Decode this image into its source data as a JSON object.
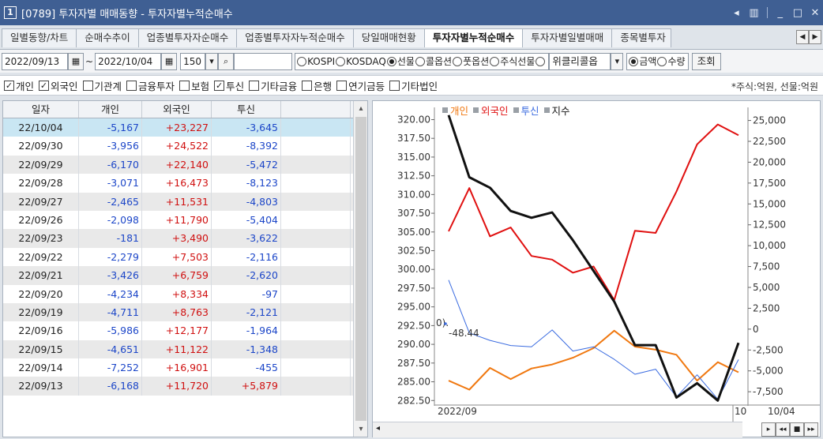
{
  "window": {
    "number": "1",
    "title": "[0789] 투자자별 매매동향 - 투자자별누적순매수",
    "controls": [
      "◂",
      "▥",
      "_",
      "□",
      "✕"
    ]
  },
  "tabs": [
    {
      "label": "일별동향/차트",
      "active": false
    },
    {
      "label": "순매수추이",
      "active": false
    },
    {
      "label": "업종별투자자순매수",
      "active": false
    },
    {
      "label": "업종별투자자누적순매수",
      "active": false
    },
    {
      "label": "당일매매현황",
      "active": false
    },
    {
      "label": "투자자별누적순매수",
      "active": true
    },
    {
      "label": "투자자별일별매매",
      "active": false
    },
    {
      "label": "종목별투자",
      "active": false
    }
  ],
  "toolbar": {
    "start_date": "2022/09/13",
    "tilde": "~",
    "end_date": "2022/10/04",
    "count": "150",
    "search_value": "",
    "markets": [
      {
        "label": "KOSPI",
        "checked": false
      },
      {
        "label": "KOSDAQ",
        "checked": false
      },
      {
        "label": "선물",
        "checked": true
      },
      {
        "label": "콜옵션",
        "checked": false
      },
      {
        "label": "풋옵션",
        "checked": false
      },
      {
        "label": "주식선물",
        "checked": false
      }
    ],
    "weekly_select": "위클리콜옵",
    "amount_types": [
      {
        "label": "금액",
        "checked": true
      },
      {
        "label": "수량",
        "checked": false
      }
    ],
    "query_button": "조회"
  },
  "filters": {
    "items": [
      {
        "label": "개인",
        "checked": true
      },
      {
        "label": "외국인",
        "checked": true
      },
      {
        "label": "기관계",
        "checked": false
      },
      {
        "label": "금융투자",
        "checked": false
      },
      {
        "label": "보험",
        "checked": false
      },
      {
        "label": "투신",
        "checked": true
      },
      {
        "label": "기타금융",
        "checked": false
      },
      {
        "label": "은행",
        "checked": false
      },
      {
        "label": "연기금등",
        "checked": false
      },
      {
        "label": "기타법인",
        "checked": false
      }
    ],
    "unit_note": "*주식:억원, 선물:억원"
  },
  "table": {
    "headers": [
      "일자",
      "개인",
      "외국인",
      "투신",
      ""
    ],
    "rows": [
      [
        "22/10/04",
        "-5,167",
        "+23,227",
        "-3,645"
      ],
      [
        "22/09/30",
        "-3,956",
        "+24,522",
        "-8,392"
      ],
      [
        "22/09/29",
        "-6,170",
        "+22,140",
        "-5,472"
      ],
      [
        "22/09/28",
        "-3,071",
        "+16,473",
        "-8,123"
      ],
      [
        "22/09/27",
        "-2,465",
        "+11,531",
        "-4,803"
      ],
      [
        "22/09/26",
        "-2,098",
        "+11,790",
        "-5,404"
      ],
      [
        "22/09/23",
        "-181",
        "+3,490",
        "-3,622"
      ],
      [
        "22/09/22",
        "-2,279",
        "+7,503",
        "-2,116"
      ],
      [
        "22/09/21",
        "-3,426",
        "+6,759",
        "-2,620"
      ],
      [
        "22/09/20",
        "-4,234",
        "+8,334",
        "-97"
      ],
      [
        "22/09/19",
        "-4,711",
        "+8,763",
        "-2,121"
      ],
      [
        "22/09/16",
        "-5,986",
        "+12,177",
        "-1,964"
      ],
      [
        "22/09/15",
        "-4,651",
        "+11,122",
        "-1,348"
      ],
      [
        "22/09/14",
        "-7,252",
        "+16,901",
        "-455"
      ],
      [
        "22/09/13",
        "-6,168",
        "+11,720",
        "+5,879"
      ]
    ]
  },
  "chart_data": {
    "type": "line",
    "x": [
      "22/09/13",
      "22/09/14",
      "22/09/15",
      "22/09/16",
      "22/09/19",
      "22/09/20",
      "22/09/21",
      "22/09/22",
      "22/09/23",
      "22/09/26",
      "22/09/27",
      "22/09/28",
      "22/09/29",
      "22/09/30",
      "22/10/04"
    ],
    "series": [
      {
        "name": "개인",
        "axis": "right",
        "color": "#f07810",
        "values": [
          -6168,
          -7252,
          -4651,
          -5986,
          -4711,
          -4234,
          -3426,
          -2279,
          -181,
          -2098,
          -2465,
          -3071,
          -6170,
          -3956,
          -5167
        ]
      },
      {
        "name": "외국인",
        "axis": "right",
        "color": "#e01010",
        "values": [
          11720,
          16901,
          11122,
          12177,
          8763,
          8334,
          6759,
          7503,
          3490,
          11790,
          11531,
          16473,
          22140,
          24522,
          23227
        ]
      },
      {
        "name": "투신",
        "axis": "right",
        "color": "#3a6be0",
        "values": [
          5879,
          -455,
          -1348,
          -1964,
          -2121,
          -97,
          -2620,
          -2116,
          -3622,
          -5404,
          -4803,
          -8123,
          -5472,
          -8392,
          -3645
        ]
      },
      {
        "name": "지수",
        "axis": "left",
        "color": "#111111",
        "values": [
          320.6,
          312.3,
          310.9,
          307.8,
          306.9,
          307.6,
          303.9,
          299.8,
          295.7,
          289.9,
          289.9,
          282.9,
          284.8,
          282.5,
          290.2
        ]
      }
    ],
    "left_ticks": [
      "320.00",
      "317.50",
      "315.00",
      "312.50",
      "310.00",
      "307.50",
      "305.00",
      "302.50",
      "300.00",
      "297.50",
      "295.00",
      "292.50",
      "290.00",
      "287.50",
      "285.00",
      "282.50"
    ],
    "right_ticks": [
      "25,000",
      "22,500",
      "20,000",
      "17,500",
      "15,000",
      "12,500",
      "10,000",
      "7,500",
      "5,000",
      "2,500",
      "0",
      "-2,500",
      "-5,000",
      "-7,500"
    ],
    "left_ylim": [
      282.0,
      321.0
    ],
    "right_ylim": [
      -9000,
      26000
    ],
    "x_labels": [
      "2022/09",
      "10",
      "10/04"
    ],
    "annotation": "-48.44",
    "annotation_mark": "0)."
  },
  "nav": {
    "btns": [
      "▸",
      "◂◂",
      "■",
      "▸▸"
    ],
    "scroll_left": "◂",
    "up": "▴",
    "down": "▾"
  }
}
